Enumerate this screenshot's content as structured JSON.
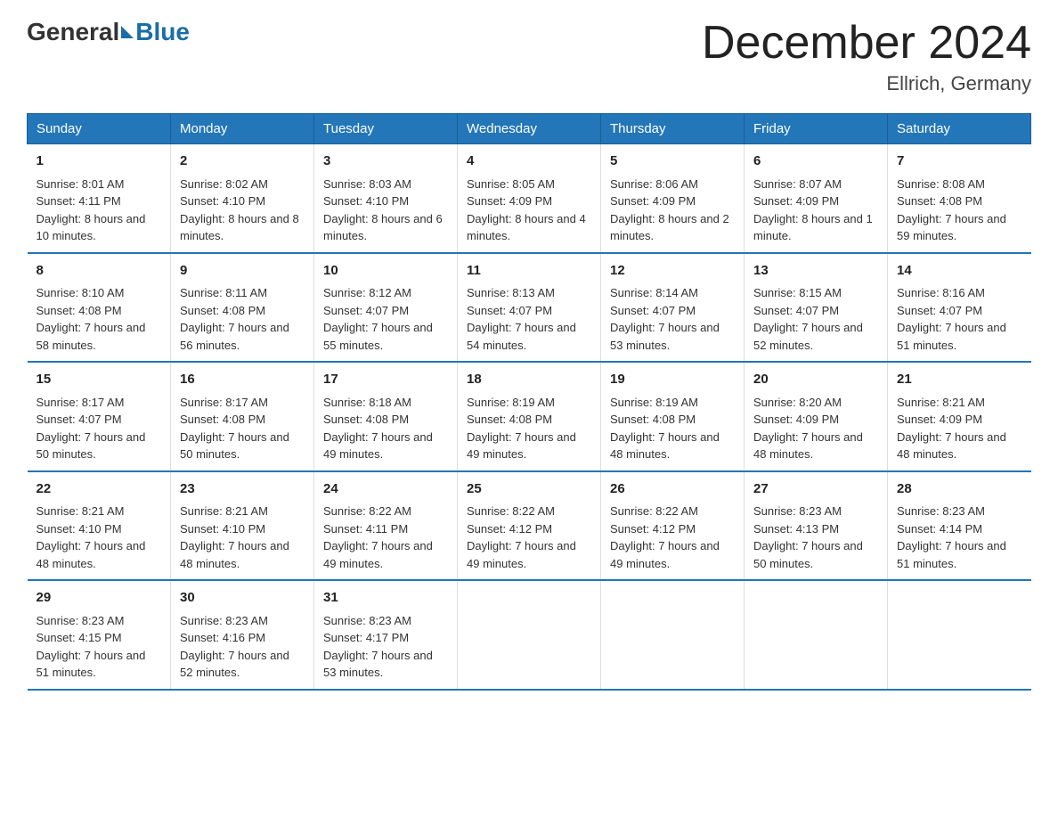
{
  "header": {
    "logo_general": "General",
    "logo_blue": "Blue",
    "month_title": "December 2024",
    "location": "Ellrich, Germany"
  },
  "weekdays": [
    "Sunday",
    "Monday",
    "Tuesday",
    "Wednesday",
    "Thursday",
    "Friday",
    "Saturday"
  ],
  "weeks": [
    [
      {
        "day": "1",
        "sunrise": "8:01 AM",
        "sunset": "4:11 PM",
        "daylight": "8 hours and 10 minutes."
      },
      {
        "day": "2",
        "sunrise": "8:02 AM",
        "sunset": "4:10 PM",
        "daylight": "8 hours and 8 minutes."
      },
      {
        "day": "3",
        "sunrise": "8:03 AM",
        "sunset": "4:10 PM",
        "daylight": "8 hours and 6 minutes."
      },
      {
        "day": "4",
        "sunrise": "8:05 AM",
        "sunset": "4:09 PM",
        "daylight": "8 hours and 4 minutes."
      },
      {
        "day": "5",
        "sunrise": "8:06 AM",
        "sunset": "4:09 PM",
        "daylight": "8 hours and 2 minutes."
      },
      {
        "day": "6",
        "sunrise": "8:07 AM",
        "sunset": "4:09 PM",
        "daylight": "8 hours and 1 minute."
      },
      {
        "day": "7",
        "sunrise": "8:08 AM",
        "sunset": "4:08 PM",
        "daylight": "7 hours and 59 minutes."
      }
    ],
    [
      {
        "day": "8",
        "sunrise": "8:10 AM",
        "sunset": "4:08 PM",
        "daylight": "7 hours and 58 minutes."
      },
      {
        "day": "9",
        "sunrise": "8:11 AM",
        "sunset": "4:08 PM",
        "daylight": "7 hours and 56 minutes."
      },
      {
        "day": "10",
        "sunrise": "8:12 AM",
        "sunset": "4:07 PM",
        "daylight": "7 hours and 55 minutes."
      },
      {
        "day": "11",
        "sunrise": "8:13 AM",
        "sunset": "4:07 PM",
        "daylight": "7 hours and 54 minutes."
      },
      {
        "day": "12",
        "sunrise": "8:14 AM",
        "sunset": "4:07 PM",
        "daylight": "7 hours and 53 minutes."
      },
      {
        "day": "13",
        "sunrise": "8:15 AM",
        "sunset": "4:07 PM",
        "daylight": "7 hours and 52 minutes."
      },
      {
        "day": "14",
        "sunrise": "8:16 AM",
        "sunset": "4:07 PM",
        "daylight": "7 hours and 51 minutes."
      }
    ],
    [
      {
        "day": "15",
        "sunrise": "8:17 AM",
        "sunset": "4:07 PM",
        "daylight": "7 hours and 50 minutes."
      },
      {
        "day": "16",
        "sunrise": "8:17 AM",
        "sunset": "4:08 PM",
        "daylight": "7 hours and 50 minutes."
      },
      {
        "day": "17",
        "sunrise": "8:18 AM",
        "sunset": "4:08 PM",
        "daylight": "7 hours and 49 minutes."
      },
      {
        "day": "18",
        "sunrise": "8:19 AM",
        "sunset": "4:08 PM",
        "daylight": "7 hours and 49 minutes."
      },
      {
        "day": "19",
        "sunrise": "8:19 AM",
        "sunset": "4:08 PM",
        "daylight": "7 hours and 48 minutes."
      },
      {
        "day": "20",
        "sunrise": "8:20 AM",
        "sunset": "4:09 PM",
        "daylight": "7 hours and 48 minutes."
      },
      {
        "day": "21",
        "sunrise": "8:21 AM",
        "sunset": "4:09 PM",
        "daylight": "7 hours and 48 minutes."
      }
    ],
    [
      {
        "day": "22",
        "sunrise": "8:21 AM",
        "sunset": "4:10 PM",
        "daylight": "7 hours and 48 minutes."
      },
      {
        "day": "23",
        "sunrise": "8:21 AM",
        "sunset": "4:10 PM",
        "daylight": "7 hours and 48 minutes."
      },
      {
        "day": "24",
        "sunrise": "8:22 AM",
        "sunset": "4:11 PM",
        "daylight": "7 hours and 49 minutes."
      },
      {
        "day": "25",
        "sunrise": "8:22 AM",
        "sunset": "4:12 PM",
        "daylight": "7 hours and 49 minutes."
      },
      {
        "day": "26",
        "sunrise": "8:22 AM",
        "sunset": "4:12 PM",
        "daylight": "7 hours and 49 minutes."
      },
      {
        "day": "27",
        "sunrise": "8:23 AM",
        "sunset": "4:13 PM",
        "daylight": "7 hours and 50 minutes."
      },
      {
        "day": "28",
        "sunrise": "8:23 AM",
        "sunset": "4:14 PM",
        "daylight": "7 hours and 51 minutes."
      }
    ],
    [
      {
        "day": "29",
        "sunrise": "8:23 AM",
        "sunset": "4:15 PM",
        "daylight": "7 hours and 51 minutes."
      },
      {
        "day": "30",
        "sunrise": "8:23 AM",
        "sunset": "4:16 PM",
        "daylight": "7 hours and 52 minutes."
      },
      {
        "day": "31",
        "sunrise": "8:23 AM",
        "sunset": "4:17 PM",
        "daylight": "7 hours and 53 minutes."
      },
      null,
      null,
      null,
      null
    ]
  ],
  "labels": {
    "sunrise": "Sunrise:",
    "sunset": "Sunset:",
    "daylight": "Daylight:"
  }
}
